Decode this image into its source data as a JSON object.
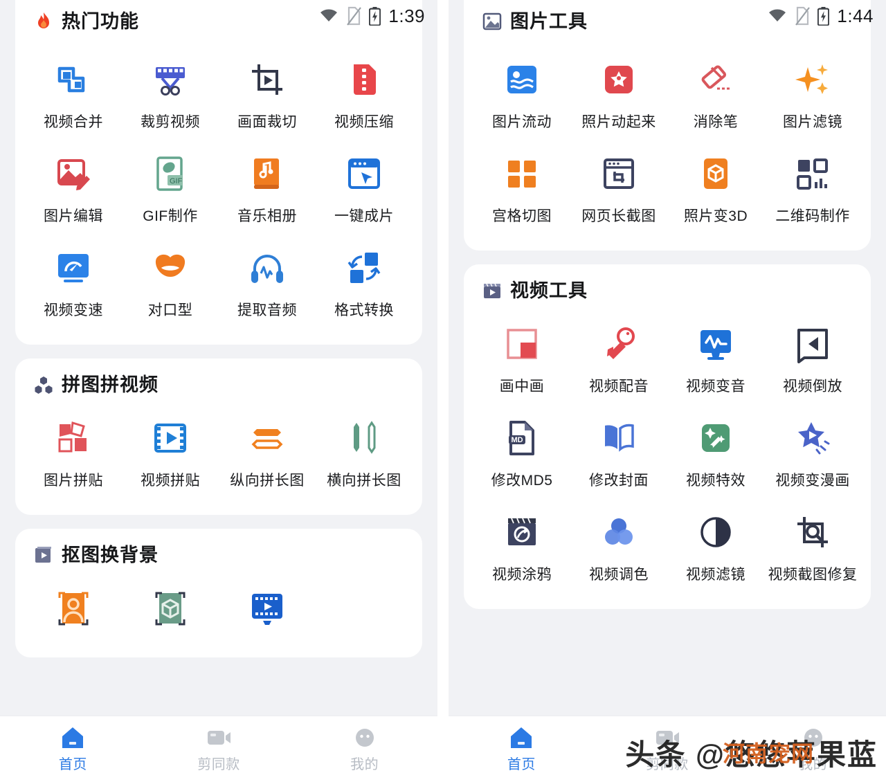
{
  "left_screen": {
    "status": {
      "time": "1:39",
      "wifi": "wifi-icon",
      "sim": "no-sim-icon",
      "battery": "battery-charging-icon"
    },
    "sections": [
      {
        "id": "hot",
        "title": "热门功能",
        "header_icon": "flame-icon",
        "tools": [
          {
            "label": "视频合并",
            "icon": "merge-icon",
            "color": "#2a7fe0"
          },
          {
            "label": "裁剪视频",
            "icon": "film-scissors-icon",
            "color": "#4a5bd0"
          },
          {
            "label": "画面裁切",
            "icon": "crop-play-icon",
            "color": "#33384a"
          },
          {
            "label": "视频压缩",
            "icon": "compress-file-icon",
            "color": "#e8464a"
          },
          {
            "label": "图片编辑",
            "icon": "photo-pencil-icon",
            "color": "#d8484f"
          },
          {
            "label": "GIF制作",
            "icon": "gif-doc-icon",
            "color": "#64a58d"
          },
          {
            "label": "音乐相册",
            "icon": "music-book-icon",
            "color": "#f07c20"
          },
          {
            "label": "一键成片",
            "icon": "window-cursor-icon",
            "color": "#1f72d8"
          },
          {
            "label": "视频变速",
            "icon": "speed-monitor-icon",
            "color": "#2b82e8"
          },
          {
            "label": "对口型",
            "icon": "lips-icon",
            "color": "#f07b20"
          },
          {
            "label": "提取音频",
            "icon": "headphone-wave-icon",
            "color": "#2f7fd6"
          },
          {
            "label": "格式转换",
            "icon": "format-convert-icon",
            "color": "#1f72d8"
          }
        ]
      },
      {
        "id": "collage",
        "title": "拼图拼视频",
        "header_icon": "three-hex-icon",
        "tools": [
          {
            "label": "图片拼贴",
            "icon": "photo-collage-icon",
            "color": "#e0545a"
          },
          {
            "label": "视频拼贴",
            "icon": "film-play-icon",
            "color": "#1f7fd6"
          },
          {
            "label": "纵向拼长图",
            "icon": "stack-vertical-icon",
            "color": "#f0801f"
          },
          {
            "label": "横向拼长图",
            "icon": "stack-horizontal-icon",
            "color": "#5f9b84"
          }
        ]
      },
      {
        "id": "cutout",
        "title": "抠图换背景",
        "header_icon": "film-frames-icon",
        "tools": [
          {
            "label": "",
            "icon": "person-cutout-icon",
            "color": "#f0801f"
          },
          {
            "label": "",
            "icon": "object-cutout-icon",
            "color": "#6a9c88"
          },
          {
            "label": "",
            "icon": "video-cutout-icon",
            "color": "#1a5fcb"
          }
        ]
      }
    ],
    "tabs": [
      {
        "label": "首页",
        "icon": "home-icon",
        "active": true
      },
      {
        "label": "剪同款",
        "icon": "camera-icon",
        "active": false
      },
      {
        "label": "我的",
        "icon": "profile-icon",
        "active": false
      }
    ]
  },
  "right_screen": {
    "status": {
      "time": "1:44",
      "wifi": "wifi-icon",
      "sim": "no-sim-icon",
      "battery": "battery-charging-icon"
    },
    "sections": [
      {
        "id": "imagetools",
        "title": "图片工具",
        "header_icon": "picture-icon",
        "tools": [
          {
            "label": "图片流动",
            "icon": "flow-image-icon",
            "color": "#2b82e8"
          },
          {
            "label": "照片动起来",
            "icon": "star-photo-icon",
            "color": "#e0484e"
          },
          {
            "label": "消除笔",
            "icon": "eraser-icon",
            "color": "#d9575c"
          },
          {
            "label": "图片滤镜",
            "icon": "sparkle-icon",
            "color": "#f59020"
          },
          {
            "label": "宫格切图",
            "icon": "grid-cut-icon",
            "color": "#ef7f20"
          },
          {
            "label": "网页长截图",
            "icon": "browser-crop-icon",
            "color": "#3d4360"
          },
          {
            "label": "照片变3D",
            "icon": "cube-3d-icon",
            "color": "#ef7f20"
          },
          {
            "label": "二维码制作",
            "icon": "qrcode-icon",
            "color": "#3d4360"
          }
        ]
      },
      {
        "id": "videotools",
        "title": "视频工具",
        "header_icon": "clapperboard-icon",
        "tools": [
          {
            "label": "画中画",
            "icon": "pip-icon",
            "color": "#e24b51"
          },
          {
            "label": "视频配音",
            "icon": "mic-dub-icon",
            "color": "#e2484f"
          },
          {
            "label": "视频变音",
            "icon": "voice-monitor-icon",
            "color": "#1f72d8"
          },
          {
            "label": "视频倒放",
            "icon": "reverse-play-icon",
            "color": "#33384a"
          },
          {
            "label": "修改MD5",
            "icon": "md5-file-icon",
            "color": "#3d4360"
          },
          {
            "label": "修改封面",
            "icon": "book-cover-icon",
            "color": "#4a74d6"
          },
          {
            "label": "视频特效",
            "icon": "magic-fx-icon",
            "color": "#4f9b74"
          },
          {
            "label": "视频变漫画",
            "icon": "star-comic-icon",
            "color": "#4a63c8"
          },
          {
            "label": "视频涂鸦",
            "icon": "doodle-clap-icon",
            "color": "#3d4360"
          },
          {
            "label": "视频调色",
            "icon": "color-circles-icon",
            "color": "#4a74d6"
          },
          {
            "label": "视频滤镜",
            "icon": "contrast-icon",
            "color": "#2d3246"
          },
          {
            "label": "视频截图修复",
            "icon": "screenshot-fix-icon",
            "color": "#33384a"
          }
        ]
      }
    ],
    "tabs": [
      {
        "label": "首页",
        "icon": "home-icon",
        "active": true
      },
      {
        "label": "剪同款",
        "icon": "camera-icon",
        "active": false
      },
      {
        "label": "我的",
        "icon": "profile-icon",
        "active": false
      }
    ]
  },
  "watermark": {
    "main": "头条 @悠悠苹果蓝",
    "sub": "河南宠网"
  },
  "theme": {
    "page_bg": "#f1f2f5",
    "card_bg": "#ffffff",
    "accent": "#2b7ae4",
    "label": "#1b1c1f"
  }
}
